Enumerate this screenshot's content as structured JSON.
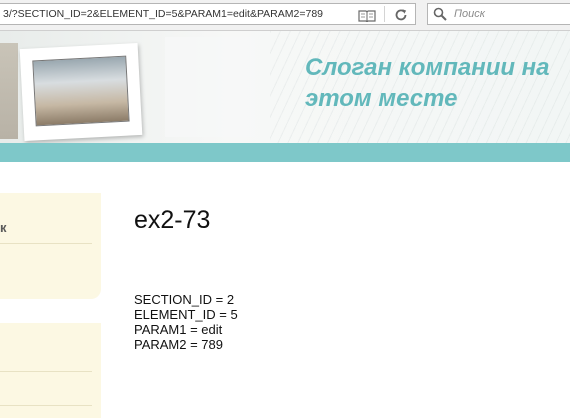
{
  "browser": {
    "url": "3/?SECTION_ID=2&ELEMENT_ID=5&PARAM1=edit&PARAM2=789",
    "search_placeholder": "Поиск",
    "reader_icon": "book-icon",
    "reload_icon": "reload-icon",
    "search_icon": "magnifier-icon"
  },
  "header": {
    "slogan": "Слоган компании на\nэтом месте",
    "accent_color": "#62b8bb",
    "band_color": "#7ec8c9"
  },
  "sidebar": {
    "box1_text": "к"
  },
  "main": {
    "title": "ex2-73",
    "params": [
      "SECTION_ID = 2",
      "ELEMENT_ID = 5",
      "PARAM1 = edit",
      "PARAM2 = 789"
    ]
  }
}
